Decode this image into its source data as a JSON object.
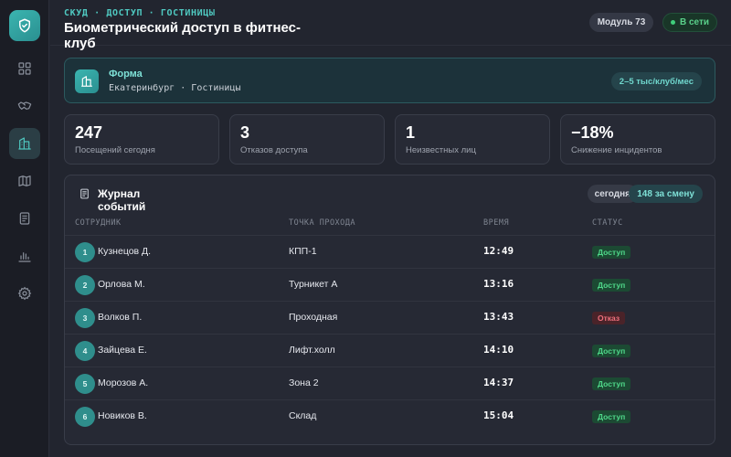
{
  "header": {
    "breadcrumb": "СКУД · ДОСТУП · ГОСТИНИЦЫ",
    "title": "Биометрический доступ в фитнес-клуб",
    "module_badge": "Модуль 73",
    "status_badge": "В сети"
  },
  "sidebar": {
    "items": [
      {
        "icon": "dashboard-icon"
      },
      {
        "icon": "handshake-icon"
      },
      {
        "icon": "building-icon"
      },
      {
        "icon": "map-icon"
      },
      {
        "icon": "document-icon"
      },
      {
        "icon": "bar-chart-icon"
      },
      {
        "icon": "settings-icon"
      }
    ],
    "active_index": 2
  },
  "form_card": {
    "title": "Форма",
    "subtitle": "Екатеринбург · Гостиницы",
    "price": "2–5 тыс/клуб/мес"
  },
  "stats": [
    {
      "value": "247",
      "label": "Посещений сегодня"
    },
    {
      "value": "3",
      "label": "Отказов доступа"
    },
    {
      "value": "1",
      "label": "Неизвестных лиц"
    },
    {
      "value": "−18%",
      "label": "Снижение инцидентов"
    }
  ],
  "journal": {
    "title": "Журнал событий",
    "filter_label": "сегодня",
    "shift_count": "148 за смену",
    "columns": [
      "СОТРУДНИК",
      "ТОЧКА ПРОХОДА",
      "ВРЕМЯ",
      "СТАТУС"
    ],
    "rows": [
      {
        "num": "1",
        "name": "Кузнецов Д.",
        "point": "КПП-1",
        "time": "12:49",
        "status": "Доступ",
        "ok": true
      },
      {
        "num": "2",
        "name": "Орлова М.",
        "point": "Турникет А",
        "time": "13:16",
        "status": "Доступ",
        "ok": true
      },
      {
        "num": "3",
        "name": "Волков П.",
        "point": "Проходная",
        "time": "13:43",
        "status": "Отказ",
        "ok": false
      },
      {
        "num": "4",
        "name": "Зайцева Е.",
        "point": "Лифт.холл",
        "time": "14:10",
        "status": "Доступ",
        "ok": true
      },
      {
        "num": "5",
        "name": "Морозов А.",
        "point": "Зона 2",
        "time": "14:37",
        "status": "Доступ",
        "ok": true
      },
      {
        "num": "6",
        "name": "Новиков В.",
        "point": "Склад",
        "time": "15:04",
        "status": "Доступ",
        "ok": true
      }
    ]
  },
  "colors": {
    "accent": "#3bb5b0",
    "background": "#22252f",
    "ok": "#4fd98a",
    "deny": "#f0707c"
  }
}
